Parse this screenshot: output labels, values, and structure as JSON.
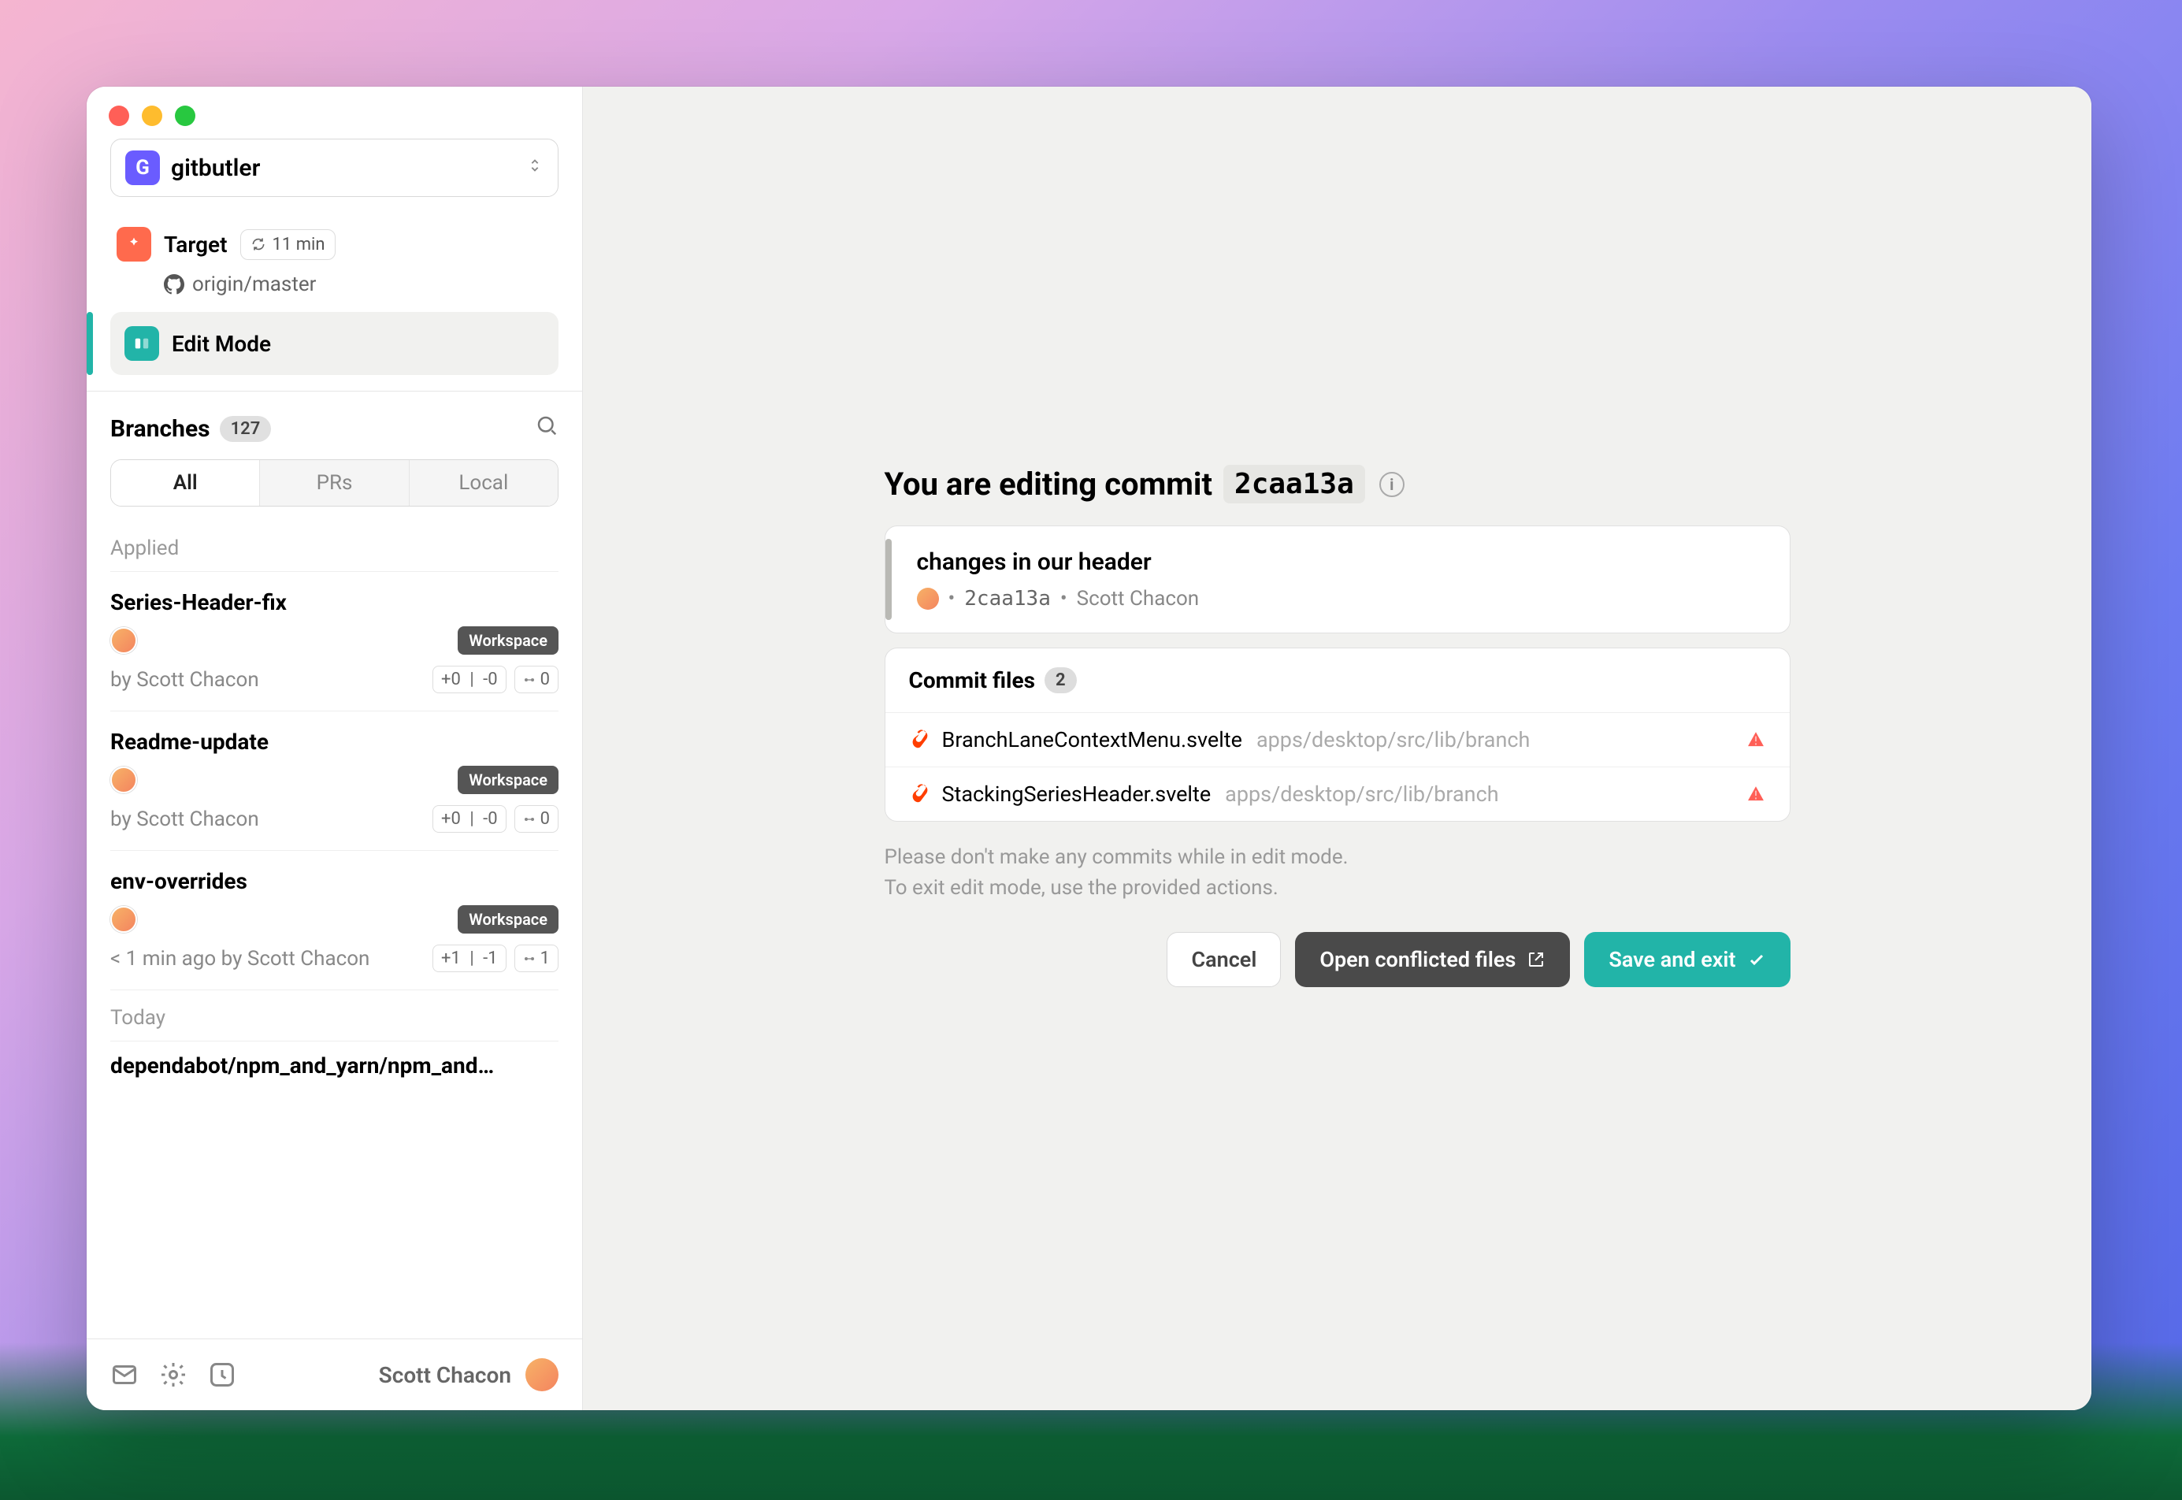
{
  "window": {
    "repo": {
      "icon_letter": "G",
      "name": "gitbutler"
    }
  },
  "sidebar": {
    "target": {
      "label": "Target",
      "refresh_badge": "11 min",
      "origin": "origin/master"
    },
    "edit_mode_label": "Edit Mode",
    "branches": {
      "title": "Branches",
      "count": "127",
      "tabs": {
        "all": "All",
        "prs": "PRs",
        "local": "Local"
      },
      "applied_label": "Applied",
      "today_label": "Today",
      "items": [
        {
          "name": "Series-Header-fix",
          "workspace_tag": "Workspace",
          "by": "by Scott Chacon",
          "added": "+0",
          "removed": "-0",
          "graph": "0"
        },
        {
          "name": "Readme-update",
          "workspace_tag": "Workspace",
          "by": "by Scott Chacon",
          "added": "+0",
          "removed": "-0",
          "graph": "0"
        },
        {
          "name": "env-overrides",
          "workspace_tag": "Workspace",
          "by": "< 1 min ago by Scott Chacon",
          "added": "+1",
          "removed": "-1",
          "graph": "1"
        }
      ],
      "today_item": "dependabot/npm_and_yarn/npm_and…"
    },
    "footer_user": "Scott Chacon"
  },
  "main": {
    "title_prefix": "You are editing commit",
    "commit_hash": "2caa13a",
    "commit": {
      "message": "changes in our header",
      "hash": "2caa13a",
      "author": "Scott Chacon"
    },
    "files_header": "Commit files",
    "files_count": "2",
    "files": [
      {
        "name": "BranchLaneContextMenu.svelte",
        "path": "apps/desktop/src/lib/branch"
      },
      {
        "name": "StackingSeriesHeader.svelte",
        "path": "apps/desktop/src/lib/branch"
      }
    ],
    "hint_line1": "Please don't make any commits while in edit mode.",
    "hint_line2": "To exit edit mode, use the provided actions.",
    "buttons": {
      "cancel": "Cancel",
      "open_conflicted": "Open conflicted files",
      "save_exit": "Save and exit"
    }
  }
}
